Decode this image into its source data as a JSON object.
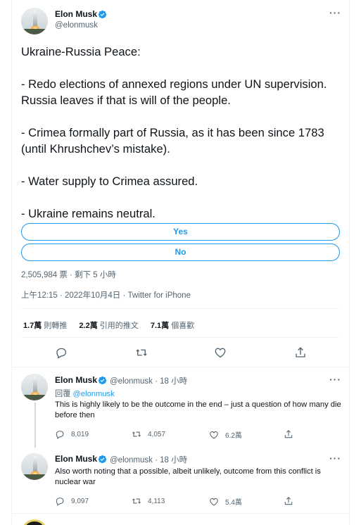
{
  "tweet": {
    "author_name": "Elon Musk",
    "author_handle": "@elonmusk",
    "more_icon": "more-icon",
    "text": "Ukraine-Russia Peace:\n\n- Redo elections of annexed regions under UN supervision. Russia leaves if that is will of the people.\n\n- Crimea formally part of Russia, as it has been since 1783 (until Khrushchev’s mistake).\n\n- Water supply to Crimea assured.\n\n- Ukraine remains neutral.",
    "poll": {
      "options": [
        "Yes",
        "No"
      ],
      "votes_and_time": "2,505,984 票 · 剩下 5 小時"
    },
    "timestamp": "上午12:15 · 2022年10月4日 · Twitter for iPhone",
    "stats": {
      "retweets_count": "1.7萬",
      "retweets_label": "則轉推",
      "quotes_count": "2.2萬",
      "quotes_label": "引用的推文",
      "likes_count": "7.1萬",
      "likes_label": "個喜歡"
    }
  },
  "replies": [
    {
      "author_name": "Elon Musk",
      "author_handle": "@elonmusk · 18 小時",
      "reply_to_label": "回覆",
      "reply_to_handle": "@elonmusk",
      "text": "This is highly likely to be the outcome in the end – just a question of how many die before then",
      "reply_count": "8,019",
      "retweet_count": "4,057",
      "like_count": "6.2萬"
    },
    {
      "author_name": "Elon Musk",
      "author_handle": "@elonmusk · 18 小時",
      "text": "Also worth noting that a possible, albeit unlikely, outcome from this conflict is nuclear war",
      "reply_count": "9,097",
      "retweet_count": "4,113",
      "like_count": "5.4萬"
    }
  ],
  "colors": {
    "accent": "#1d9bf0",
    "text": "#0f1419",
    "secondary": "#536471",
    "border": "#eff3f4"
  }
}
